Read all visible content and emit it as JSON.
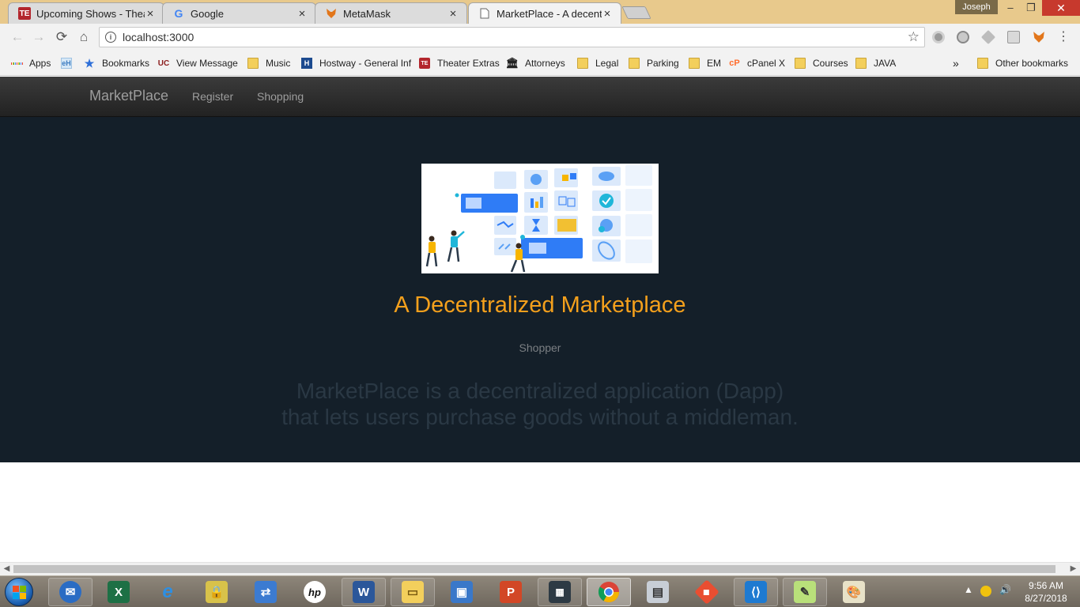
{
  "browser": {
    "tabs": [
      {
        "title": "Upcoming Shows - Theat",
        "icon": "theater-icon",
        "close": "×"
      },
      {
        "title": "Google",
        "icon": "google-icon",
        "close": "×"
      },
      {
        "title": "MetaMask",
        "icon": "metamask-fox-icon",
        "close": "×"
      },
      {
        "title": "MarketPlace - A decentra",
        "icon": "page-icon",
        "close": "×"
      }
    ],
    "user": "Joseph",
    "window_controls": {
      "minimize": "–",
      "maximize": "❐",
      "close": "✕"
    },
    "nav": {
      "back": "←",
      "forward": "→",
      "reload": "⟳",
      "home": "⌂"
    },
    "url": "localhost:3000",
    "bookmarks": [
      {
        "label": "Apps"
      },
      {
        "label": "Bookmarks"
      },
      {
        "label": "View Message"
      },
      {
        "label": "Music"
      },
      {
        "label": "Hostway - General Inf"
      },
      {
        "label": "Theater Extras"
      },
      {
        "label": "Attorneys"
      },
      {
        "label": "Legal"
      },
      {
        "label": "Parking"
      },
      {
        "label": "EM"
      },
      {
        "label": "cPanel X"
      },
      {
        "label": "Courses"
      },
      {
        "label": "JAVA"
      }
    ],
    "more_bookmarks": "»",
    "other_bookmarks": "Other bookmarks"
  },
  "page": {
    "navbar": {
      "brand": "MarketPlace",
      "links": [
        "Register",
        "Shopping"
      ]
    },
    "hero": {
      "title": "A Decentralized Marketplace",
      "subtitle": "Shopper",
      "description_line1": "MarketPlace is a decentralized application (Dapp)",
      "description_line2": "that lets users purchase goods without a middleman.",
      "title_color": "#f4a01c",
      "background_color": "#141f29"
    }
  },
  "taskbar": {
    "apps": [
      "thunderbird-icon",
      "excel-icon",
      "internet-explorer-icon",
      "lock-file-icon",
      "sync-icon",
      "hp-icon",
      "word-icon",
      "file-explorer-icon",
      "remote-desktop-icon",
      "powerpoint-icon",
      "calculator-icon",
      "chrome-icon",
      "monitor-icon",
      "git-icon",
      "vscode-icon",
      "notepad-icon",
      "paint-icon"
    ],
    "clock_time": "9:56 AM",
    "clock_date": "8/27/2018"
  }
}
